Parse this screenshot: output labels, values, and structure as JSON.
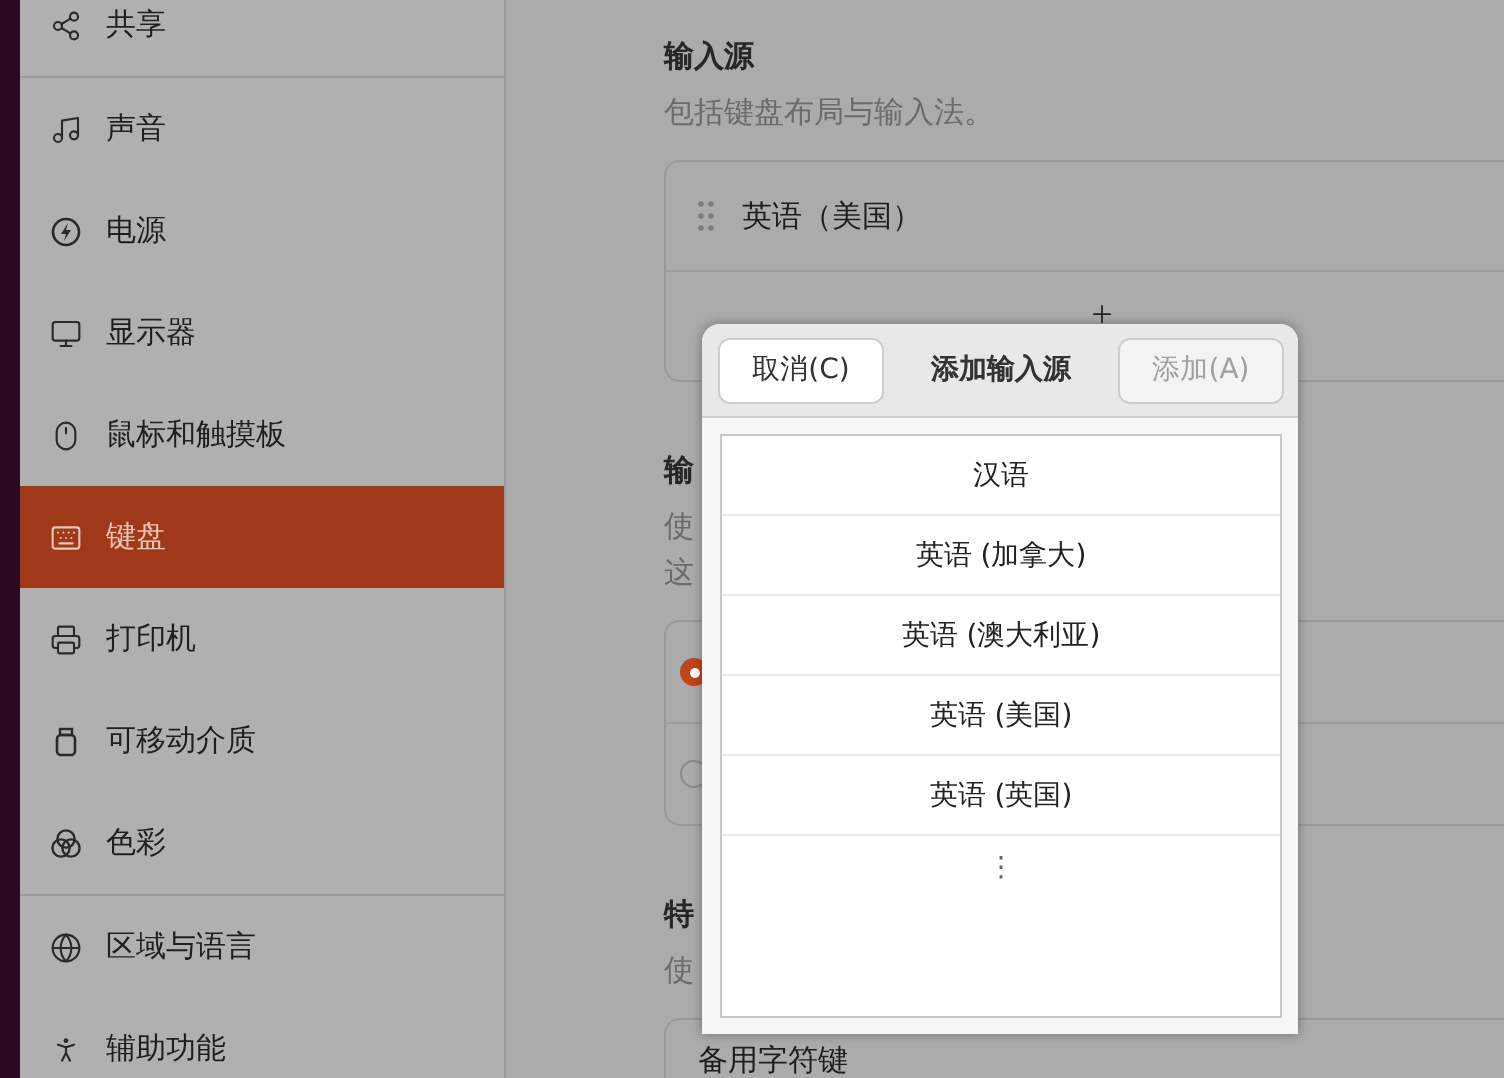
{
  "sidebar": {
    "groups": [
      {
        "items": [
          {
            "label": "共享",
            "selected": false
          }
        ]
      },
      {
        "items": [
          {
            "label": "声音",
            "selected": false
          },
          {
            "label": "电源",
            "selected": false
          },
          {
            "label": "显示器",
            "selected": false
          },
          {
            "label": "鼠标和触摸板",
            "selected": false
          },
          {
            "label": "键盘",
            "selected": true
          },
          {
            "label": "打印机",
            "selected": false
          },
          {
            "label": "可移动介质",
            "selected": false
          },
          {
            "label": "色彩",
            "selected": false
          }
        ]
      },
      {
        "items": [
          {
            "label": "区域与语言",
            "selected": false
          },
          {
            "label": "辅助功能",
            "selected": false
          }
        ]
      }
    ]
  },
  "sections": [
    {
      "title": "输入源",
      "description": [
        "包括键盘布局与输入法。"
      ],
      "rows": [
        {
          "kind": "source",
          "label": "英语（美国）"
        },
        {
          "kind": "add"
        }
      ]
    },
    {
      "title": "输",
      "description": [
        "使",
        "这"
      ],
      "rows": [
        {
          "kind": "radio",
          "selected": true
        },
        {
          "kind": "radio",
          "selected": false
        }
      ]
    },
    {
      "title": "特",
      "description": [
        "使"
      ],
      "rows": [
        {
          "kind": "text",
          "label": "备用字符键"
        }
      ]
    }
  ],
  "dialog": {
    "title": "添加输入源",
    "cancel": {
      "label": "取消(C)",
      "disabled": false
    },
    "confirm": {
      "label": "添加(A)",
      "disabled": true
    },
    "items": [
      {
        "kind": "language",
        "label": "汉语"
      },
      {
        "kind": "language",
        "label": "英语 (加拿大)"
      },
      {
        "kind": "language",
        "label": "英语 (澳大利亚)"
      },
      {
        "kind": "language",
        "label": "英语 (美国)"
      },
      {
        "kind": "language",
        "label": "英语 (英国)"
      },
      {
        "kind": "more",
        "label": "⋮"
      }
    ]
  }
}
